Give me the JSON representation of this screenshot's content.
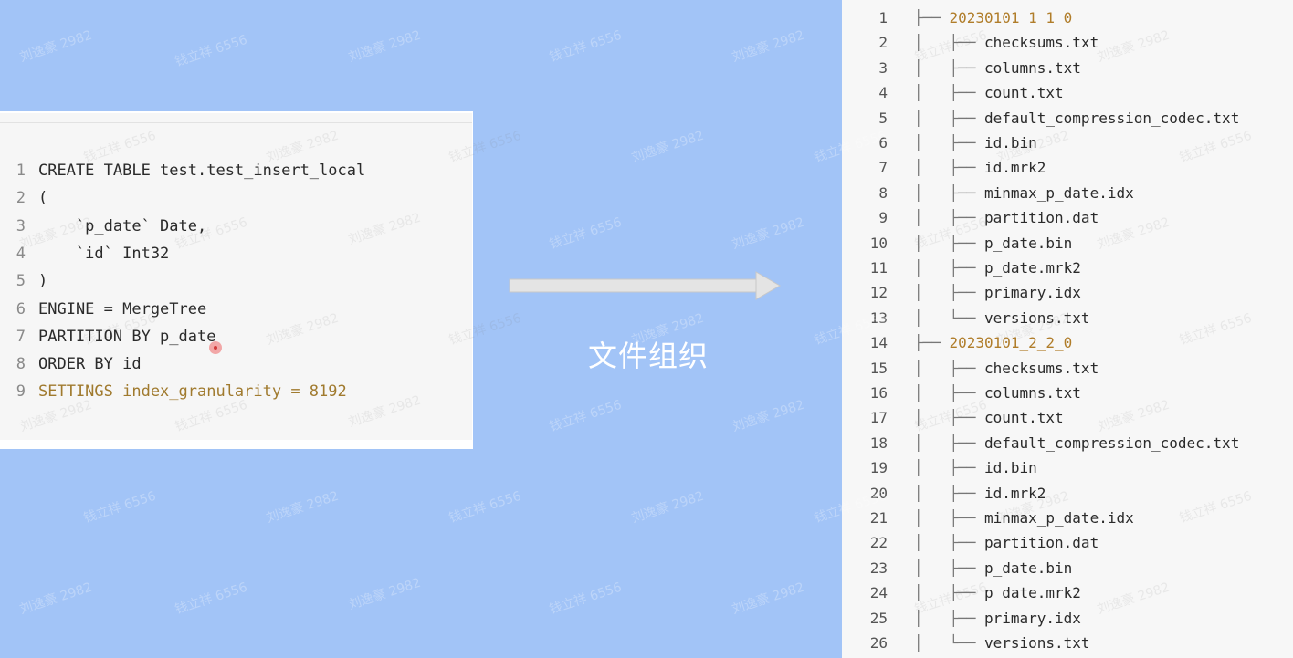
{
  "sql": {
    "lines": [
      {
        "n": "1",
        "code": "CREATE TABLE test.test_insert_local"
      },
      {
        "n": "2",
        "code": "("
      },
      {
        "n": "3",
        "code": "    `p_date` Date,"
      },
      {
        "n": "4",
        "code": "    `id` Int32"
      },
      {
        "n": "5",
        "code": ")"
      },
      {
        "n": "6",
        "code": "ENGINE = MergeTree"
      },
      {
        "n": "7",
        "code": "PARTITION BY p_date"
      },
      {
        "n": "8",
        "code": "ORDER BY id"
      },
      {
        "n": "9",
        "code": "SETTINGS index_granularity = 8192"
      }
    ]
  },
  "caption": "文件组织",
  "tree": {
    "lines": [
      {
        "n": "1",
        "prefix": "├── ",
        "name": "20230101_1_1_0",
        "folder": true
      },
      {
        "n": "2",
        "prefix": "│   ├── ",
        "name": "checksums.txt"
      },
      {
        "n": "3",
        "prefix": "│   ├── ",
        "name": "columns.txt"
      },
      {
        "n": "4",
        "prefix": "│   ├── ",
        "name": "count.txt"
      },
      {
        "n": "5",
        "prefix": "│   ├── ",
        "name": "default_compression_codec.txt"
      },
      {
        "n": "6",
        "prefix": "│   ├── ",
        "name": "id.bin"
      },
      {
        "n": "7",
        "prefix": "│   ├── ",
        "name": "id.mrk2"
      },
      {
        "n": "8",
        "prefix": "│   ├── ",
        "name": "minmax_p_date.idx"
      },
      {
        "n": "9",
        "prefix": "│   ├── ",
        "name": "partition.dat"
      },
      {
        "n": "10",
        "prefix": "│   ├── ",
        "name": "p_date.bin"
      },
      {
        "n": "11",
        "prefix": "│   ├── ",
        "name": "p_date.mrk2"
      },
      {
        "n": "12",
        "prefix": "│   ├── ",
        "name": "primary.idx"
      },
      {
        "n": "13",
        "prefix": "│   └── ",
        "name": "versions.txt"
      },
      {
        "n": "14",
        "prefix": "├── ",
        "name": "20230101_2_2_0",
        "folder": true
      },
      {
        "n": "15",
        "prefix": "│   ├── ",
        "name": "checksums.txt"
      },
      {
        "n": "16",
        "prefix": "│   ├── ",
        "name": "columns.txt"
      },
      {
        "n": "17",
        "prefix": "│   ├── ",
        "name": "count.txt"
      },
      {
        "n": "18",
        "prefix": "│   ├── ",
        "name": "default_compression_codec.txt"
      },
      {
        "n": "19",
        "prefix": "│   ├── ",
        "name": "id.bin"
      },
      {
        "n": "20",
        "prefix": "│   ├── ",
        "name": "id.mrk2"
      },
      {
        "n": "21",
        "prefix": "│   ├── ",
        "name": "minmax_p_date.idx"
      },
      {
        "n": "22",
        "prefix": "│   ├── ",
        "name": "partition.dat"
      },
      {
        "n": "23",
        "prefix": "│   ├── ",
        "name": "p_date.bin"
      },
      {
        "n": "24",
        "prefix": "│   ├── ",
        "name": "p_date.mrk2"
      },
      {
        "n": "25",
        "prefix": "│   ├── ",
        "name": "primary.idx"
      },
      {
        "n": "26",
        "prefix": "│   └── ",
        "name": "versions.txt"
      }
    ]
  },
  "watermarks": [
    "刘逸豪 2982",
    "钱立祥 6556"
  ],
  "colors": {
    "background": "#a2c4f7",
    "folder": "#b07d2a",
    "settings": "#a07a2e"
  }
}
